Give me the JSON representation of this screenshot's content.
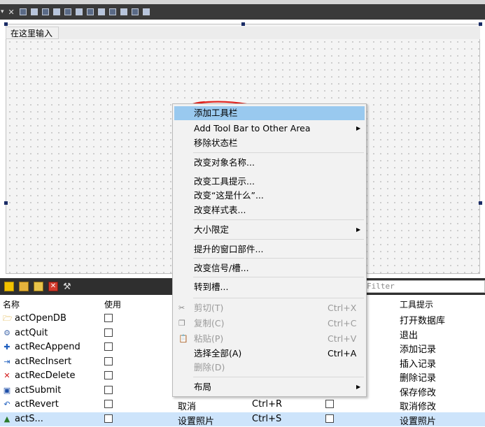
{
  "form": {
    "placeholder_tab": "在这里输入"
  },
  "action_editor": {
    "filter_placeholder": "Filter",
    "columns": {
      "name": "名称",
      "used": "使用",
      "tooltip": "工具提示"
    },
    "rows": [
      {
        "icon": "folder-open-icon",
        "name": "actOpenDB",
        "text": "",
        "shortcut": "",
        "checkable": false,
        "tooltip": "打开数据库"
      },
      {
        "icon": "quit-icon",
        "name": "actQuit",
        "text": "",
        "shortcut": "",
        "checkable": false,
        "tooltip": "退出"
      },
      {
        "icon": "plus-icon",
        "name": "actRecAppend",
        "text": "",
        "shortcut": "",
        "checkable": false,
        "tooltip": "添加记录"
      },
      {
        "icon": "insert-icon",
        "name": "actRecInsert",
        "text": "",
        "shortcut": "",
        "checkable": false,
        "tooltip": "插入记录"
      },
      {
        "icon": "delete-x-icon",
        "name": "actRecDelete",
        "text": "",
        "shortcut": "",
        "checkable": false,
        "tooltip": "删除记录"
      },
      {
        "icon": "save-icon",
        "name": "actSubmit",
        "text": "",
        "shortcut": "",
        "checkable": false,
        "tooltip": "保存修改"
      },
      {
        "icon": "undo-icon",
        "name": "actRevert",
        "text": "取消",
        "shortcut": "Ctrl+R",
        "checkable": false,
        "tooltip": "取消修改"
      },
      {
        "icon": "photo-icon",
        "name": "actS...",
        "text": "设置照片",
        "shortcut": "Ctrl+S",
        "checkable": false,
        "tooltip": "设置照片"
      }
    ]
  },
  "context_menu": {
    "items": [
      {
        "label": "添加工具栏",
        "shortcut": "",
        "submenu": false,
        "disabled": false,
        "highlighted": true
      },
      {
        "label": "Add Tool Bar to Other Area",
        "shortcut": "",
        "submenu": true,
        "disabled": false,
        "highlighted": false
      },
      {
        "label": "移除状态栏",
        "shortcut": "",
        "submenu": false,
        "disabled": false,
        "highlighted": false
      },
      {
        "label": "改变对象名称...",
        "shortcut": "",
        "submenu": false,
        "disabled": false,
        "highlighted": false
      },
      {
        "label": "改变工具提示...",
        "shortcut": "",
        "submenu": false,
        "disabled": false,
        "highlighted": false
      },
      {
        "label": "改变“这是什么”...",
        "shortcut": "",
        "submenu": false,
        "disabled": false,
        "highlighted": false
      },
      {
        "label": "改变样式表...",
        "shortcut": "",
        "submenu": false,
        "disabled": false,
        "highlighted": false
      },
      {
        "label": "大小限定",
        "shortcut": "",
        "submenu": true,
        "disabled": false,
        "highlighted": false
      },
      {
        "label": "提升的窗口部件...",
        "shortcut": "",
        "submenu": false,
        "disabled": false,
        "highlighted": false
      },
      {
        "label": "改变信号/槽...",
        "shortcut": "",
        "submenu": false,
        "disabled": false,
        "highlighted": false
      },
      {
        "label": "转到槽...",
        "shortcut": "",
        "submenu": false,
        "disabled": false,
        "highlighted": false
      },
      {
        "label": "剪切(T)",
        "shortcut": "Ctrl+X",
        "submenu": false,
        "disabled": true,
        "highlighted": false,
        "icon": "scissors-icon"
      },
      {
        "label": "复制(C)",
        "shortcut": "Ctrl+C",
        "submenu": false,
        "disabled": true,
        "highlighted": false,
        "icon": "copy-icon"
      },
      {
        "label": "粘贴(P)",
        "shortcut": "Ctrl+V",
        "submenu": false,
        "disabled": true,
        "highlighted": false,
        "icon": "paste-icon"
      },
      {
        "label": "选择全部(A)",
        "shortcut": "Ctrl+A",
        "submenu": false,
        "disabled": false,
        "highlighted": false
      },
      {
        "label": "删除(D)",
        "shortcut": "",
        "submenu": false,
        "disabled": true,
        "highlighted": false
      },
      {
        "label": "布局",
        "shortcut": "",
        "submenu": true,
        "disabled": false,
        "highlighted": false
      }
    ]
  }
}
